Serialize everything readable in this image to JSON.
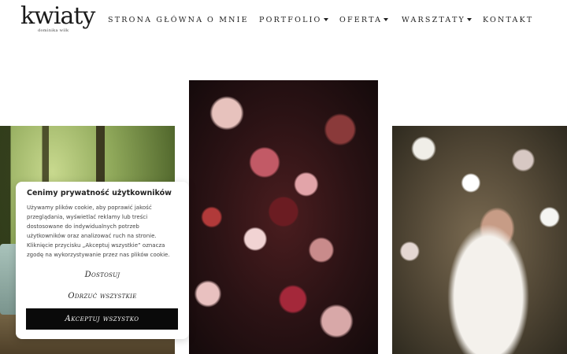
{
  "brand": {
    "logo": "kwiaty",
    "tagline": "dominika wilk"
  },
  "nav": {
    "items": [
      {
        "label": "STRONA GŁÓWNA",
        "dropdown": false
      },
      {
        "label": "O MNIE",
        "dropdown": false
      },
      {
        "label": "PORTFOLIO",
        "dropdown": true
      },
      {
        "label": "OFERTA",
        "dropdown": true
      },
      {
        "label": "WARSZTATY",
        "dropdown": true
      },
      {
        "label": "KONTAKT",
        "dropdown": false
      }
    ]
  },
  "gallery": {
    "images": [
      "forest-wedding-photo",
      "dark-flowers-photo",
      "bride-in-flowers-photo"
    ]
  },
  "cookie_banner": {
    "title": "Cenimy prywatność użytkowników",
    "text_lines": [
      "Używamy plików cookie, aby poprawić jakość",
      "przeglądania, wyświetlać reklamy lub treści",
      "dostosowane do indywidualnych potrzeb",
      "użytkowników oraz analizować ruch na stronie.",
      "Kliknięcie przycisku „Akceptuj wszystkie” oznacza",
      "zgodę na wykorzystywanie przez nas plików cookie."
    ],
    "customize_label": "Dostosuj",
    "reject_label": "Odrzuć wszystkie",
    "accept_label": "Akceptuj wszystko"
  },
  "colors": {
    "accept_bg": "#0a0a0a",
    "text": "#222222",
    "background": "#ffffff"
  }
}
